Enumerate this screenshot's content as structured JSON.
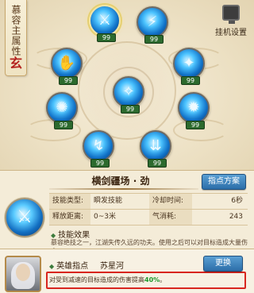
{
  "side_banner": {
    "title": "慕容主属性",
    "element": "玄"
  },
  "settings": {
    "label": "挂机设置",
    "icon": "monitor-icon"
  },
  "skills": [
    {
      "id": "blade-wave",
      "icon": "sword-slash-icon",
      "level": "99",
      "selected": true
    },
    {
      "id": "sword-rain",
      "icon": "sword-icon",
      "level": "99",
      "selected": false
    },
    {
      "id": "palm-strike",
      "icon": "palm-icon",
      "level": "99",
      "selected": false
    },
    {
      "id": "energy-body",
      "icon": "figure-icon",
      "level": "99",
      "selected": false
    },
    {
      "id": "flying-swords",
      "icon": "multi-sword-icon",
      "level": "99",
      "selected": false
    },
    {
      "id": "blade-storm",
      "icon": "whirl-icon",
      "level": "99",
      "selected": false
    },
    {
      "id": "radiant-burst",
      "icon": "burst-icon",
      "level": "99",
      "selected": false
    },
    {
      "id": "sword-fall",
      "icon": "sword-down-icon",
      "level": "99",
      "selected": false
    },
    {
      "id": "triple-sword",
      "icon": "triple-sword-icon",
      "level": "99",
      "selected": false
    }
  ],
  "info": {
    "skill_name": "横剑疆场 · 劲",
    "plan_button": "指点方案",
    "stats": [
      {
        "k1": "技能类型:",
        "v1": "瞬发技能",
        "k2": "冷却时间:",
        "v2": "6秒"
      },
      {
        "k1": "释放距离:",
        "v1": "0~3米",
        "k2": "气消耗:",
        "v2": "243"
      }
    ],
    "effect_title": "技能效果",
    "effect_desc": "慕容绝技之一，江湖失传久远的功夫。使用之后可以对目标造成大量伤害。"
  },
  "hero": {
    "label": "英雄指点",
    "name": "苏星河",
    "change_button": "更换",
    "tip_prefix": "对受到减速的目标造成的伤害提高",
    "tip_percent": "40%",
    "tip_suffix": "。"
  },
  "colors": {
    "tip_highlight": "#1e9a2d",
    "tip_border": "#d8261f",
    "button": "#2b6ea9"
  }
}
